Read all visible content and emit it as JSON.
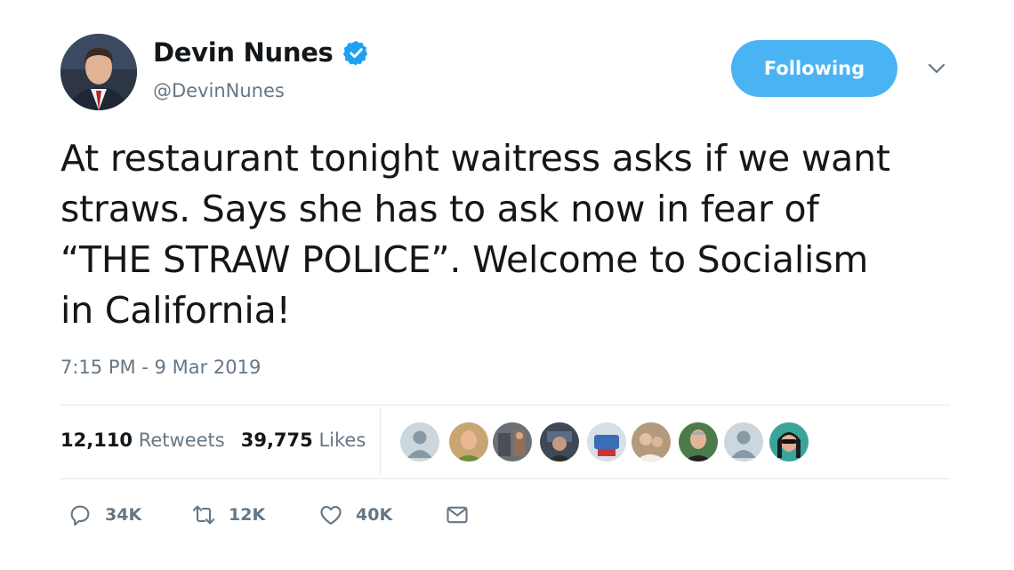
{
  "author": {
    "display_name": "Devin Nunes",
    "handle": "@DevinNunes",
    "verified": true,
    "avatar": "profile-photo"
  },
  "follow_button": {
    "label": "Following",
    "color": "#4ab3f4"
  },
  "menu": {
    "icon": "chevron-down-icon"
  },
  "tweet": {
    "text": "At restaurant tonight waitress asks if we want\nstraws. Says she has to ask now in fear of\n“THE STRAW POLICE”. Welcome to Socialism\nin California!",
    "timestamp": "7:15 PM - 9 Mar 2019"
  },
  "stats": {
    "retweets": {
      "count": "12,110",
      "label": "Retweets"
    },
    "likes": {
      "count": "39,775",
      "label": "Likes"
    }
  },
  "facepile": [
    "default-avatar",
    "user-avatar",
    "user-avatar",
    "user-avatar",
    "user-avatar",
    "user-avatar",
    "user-avatar",
    "default-avatar",
    "user-avatar"
  ],
  "actions": {
    "reply": {
      "icon": "reply-icon",
      "count": "34K"
    },
    "retweet": {
      "icon": "retweet-icon",
      "count": "12K"
    },
    "like": {
      "icon": "heart-icon",
      "count": "40K"
    },
    "message": {
      "icon": "envelope-icon"
    }
  },
  "colors": {
    "text": "#14171a",
    "muted": "#657786",
    "accent": "#1da1f2",
    "divider": "#e1e8ed"
  }
}
